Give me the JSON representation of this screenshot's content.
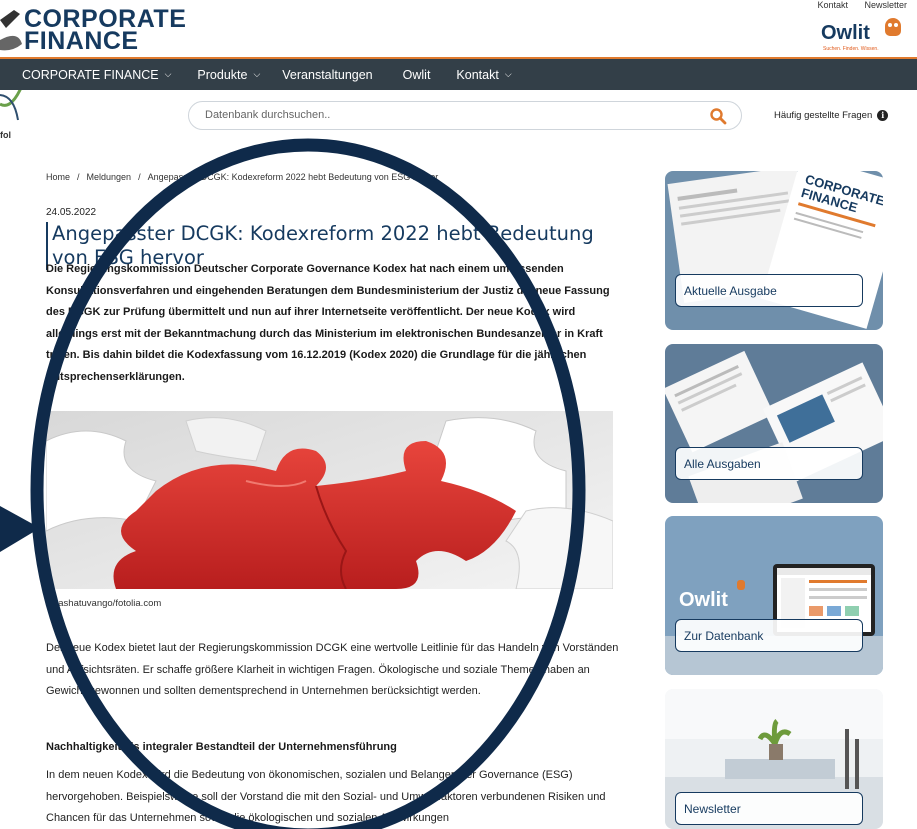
{
  "header": {
    "logo_line1": "CORPORATE",
    "logo_line2": "FINANCE",
    "top_links": [
      "Kontakt",
      "Newsletter"
    ],
    "owlit": {
      "name": "Owlit",
      "tagline": "Suchen. Finden. Wissen."
    },
    "edge_text": "fol"
  },
  "nav": {
    "items": [
      {
        "label": "CORPORATE FINANCE",
        "dropdown": true
      },
      {
        "label": "Produkte",
        "dropdown": true
      },
      {
        "label": "Veranstaltungen",
        "dropdown": false
      },
      {
        "label": "Owlit",
        "dropdown": false
      },
      {
        "label": "Kontakt",
        "dropdown": true
      }
    ]
  },
  "search": {
    "placeholder": "Datenbank durchsuchen..",
    "faq_label": "Häufig gestellte Fragen"
  },
  "breadcrumb": {
    "home": "Home",
    "section": "Meldungen",
    "current": "Angepasster DCGK: Kodexreform 2022 hebt Bedeutung von ESG hervor"
  },
  "article": {
    "date": "24.05.2022",
    "title": "Angepasster DCGK: Kodexreform 2022 hebt Bedeutung von ESG hervor",
    "lead": "Die Regierungskommission Deutscher Corporate Governance Kodex hat nach einem umfassenden Konsultationsverfahren und eingehenden Beratungen dem Bundesministerium der Justiz die neue Fassung des DCGK zur Prüfung übermittelt und nun auf ihrer Internetseite veröffentlicht. Der neue Kodex wird allerdings erst mit der Bekanntmachung durch das Ministerium im elektronischen Bundesanzeiger in Kraft treten. Bis dahin bildet die Kodexfassung vom 16.12.2019 (Kodex 2020) die Grundlage für die jährlichen Entsprechenserklärungen.",
    "photo_credit": "© tashatuvango/fotolia.com",
    "paragraph1": "Der neue Kodex bietet laut der Regierungskommission DCGK eine wertvolle Leitlinie für das Handeln von Vorständen und Aufsichtsräten. Er schaffe größere Klarheit in wichtigen Fragen. Ökologische und soziale Themen haben an Gewicht gewonnen und sollten dementsprechend in Unternehmen berücksichtigt werden.",
    "subheading": "Nachhaltigkeit als integraler Bestandteil der Unternehmensführung",
    "paragraph2": "In dem neuen Kodex wird die Bedeutung von ökonomischen, sozialen und Belangen der Governance (ESG) hervorgehoben. Beispielsweise soll der Vorstand die mit den Sozial- und Umweltfaktoren verbundenen Risiken und Chancen für das Unternehmen sowie die ökologischen und sozialen Auswirkungen"
  },
  "sidebar": {
    "cards": [
      {
        "label": "Aktuelle Ausgabe"
      },
      {
        "label": "Alle Ausgaben"
      },
      {
        "label": "Zur Datenbank",
        "brand": "Owlit"
      },
      {
        "label": "Newsletter"
      }
    ],
    "magazine_cover_text": "CORPORATE FINANCE"
  },
  "colors": {
    "brand_navy": "#163a5f",
    "accent_orange": "#e07a2e",
    "nav_bg": "#333f48",
    "overlay_circle": "#0f2a4a"
  }
}
